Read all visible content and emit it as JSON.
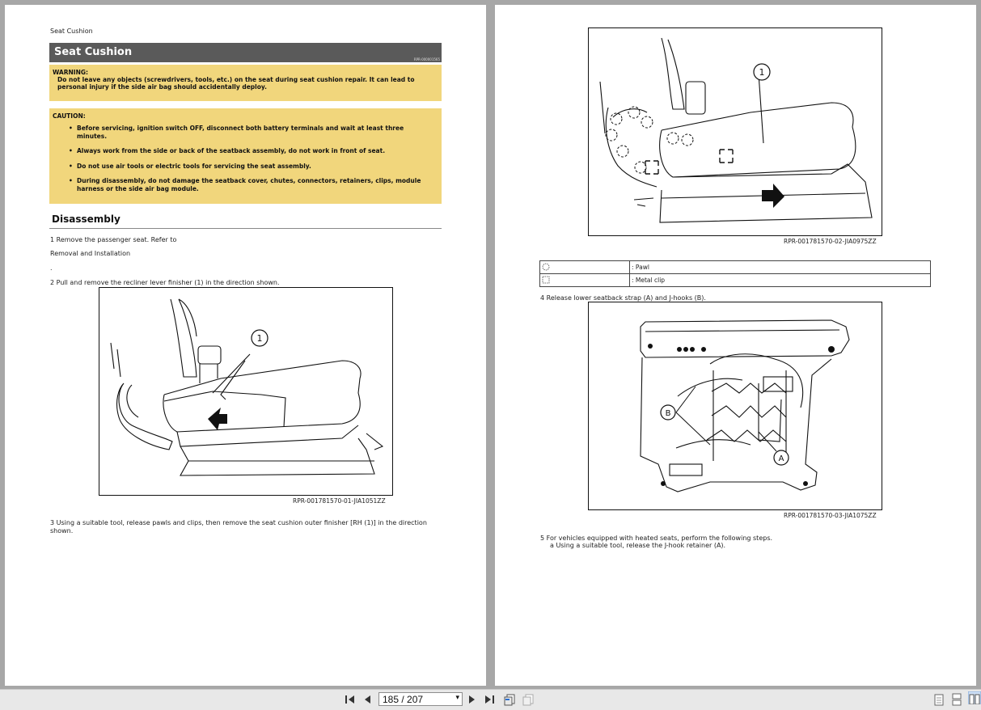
{
  "left_page": {
    "header": "Seat Cushion",
    "title": "Seat Cushion",
    "title_code": "RPR-000001565",
    "warning_label": "WARNING:",
    "warning_text": "Do not leave any objects (screwdrivers, tools, etc.) on the seat during seat cushion repair. It can lead to personal injury if the side air bag should accidentally deploy.",
    "caution_label": "CAUTION:",
    "caution_items": [
      "Before servicing, ignition switch OFF, disconnect both battery terminals and wait at least three minutes.",
      "Always work from the side or back of the seatback assembly, do not work in front of seat.",
      "Do not use air tools or electric tools for servicing the seat assembly.",
      "During disassembly, do not damage the seatback cover, chutes, connectors, retainers, clips, module harness or the side air bag module."
    ],
    "section_title": "Disassembly",
    "step1a": "1 Remove the passenger seat. Refer to",
    "step1b": "Removal and Installation",
    "step1c": ".",
    "step2": "2 Pull and remove the recliner lever finisher (1) in the direction shown.",
    "figure1_callout": "1",
    "figure1_id": "RPR-001781570-01-JIA1051ZZ",
    "step3": "3 Using a suitable tool, release pawls and clips, then remove the seat cushion outer finisher [RH (1)] in the direction shown."
  },
  "right_page": {
    "figure2_callout": "1",
    "figure2_id": "RPR-001781570-02-JIA0975ZZ",
    "legend": [
      {
        "symbol": "pawl-symbol",
        "label": ": Pawl"
      },
      {
        "symbol": "metal-clip-symbol",
        "label": ": Metal clip"
      }
    ],
    "step4": "4 Release lower seatback strap (A) and J-hooks (B).",
    "figure3_callout_a": "A",
    "figure3_callout_b": "B",
    "figure3_id": "RPR-001781570-03-JIA1075ZZ",
    "step5": "5 For vehicles equipped with heated seats, perform the following steps.",
    "step5a": "a Using a suitable tool, release the J-hook retainer (A)."
  },
  "toolbar": {
    "page_value": "185 / 207",
    "icons": [
      "first-page-icon",
      "previous-page-icon",
      "next-page-icon",
      "last-page-icon",
      "go-back-view-icon",
      "go-forward-view-icon",
      "single-page-view-icon",
      "continuous-view-icon",
      "facing-pages-view-icon"
    ]
  },
  "colors": {
    "title_bar": "#5a5a5a",
    "warning_bg": "#f1d67c",
    "viewer_bg": "#a7a7a7"
  }
}
